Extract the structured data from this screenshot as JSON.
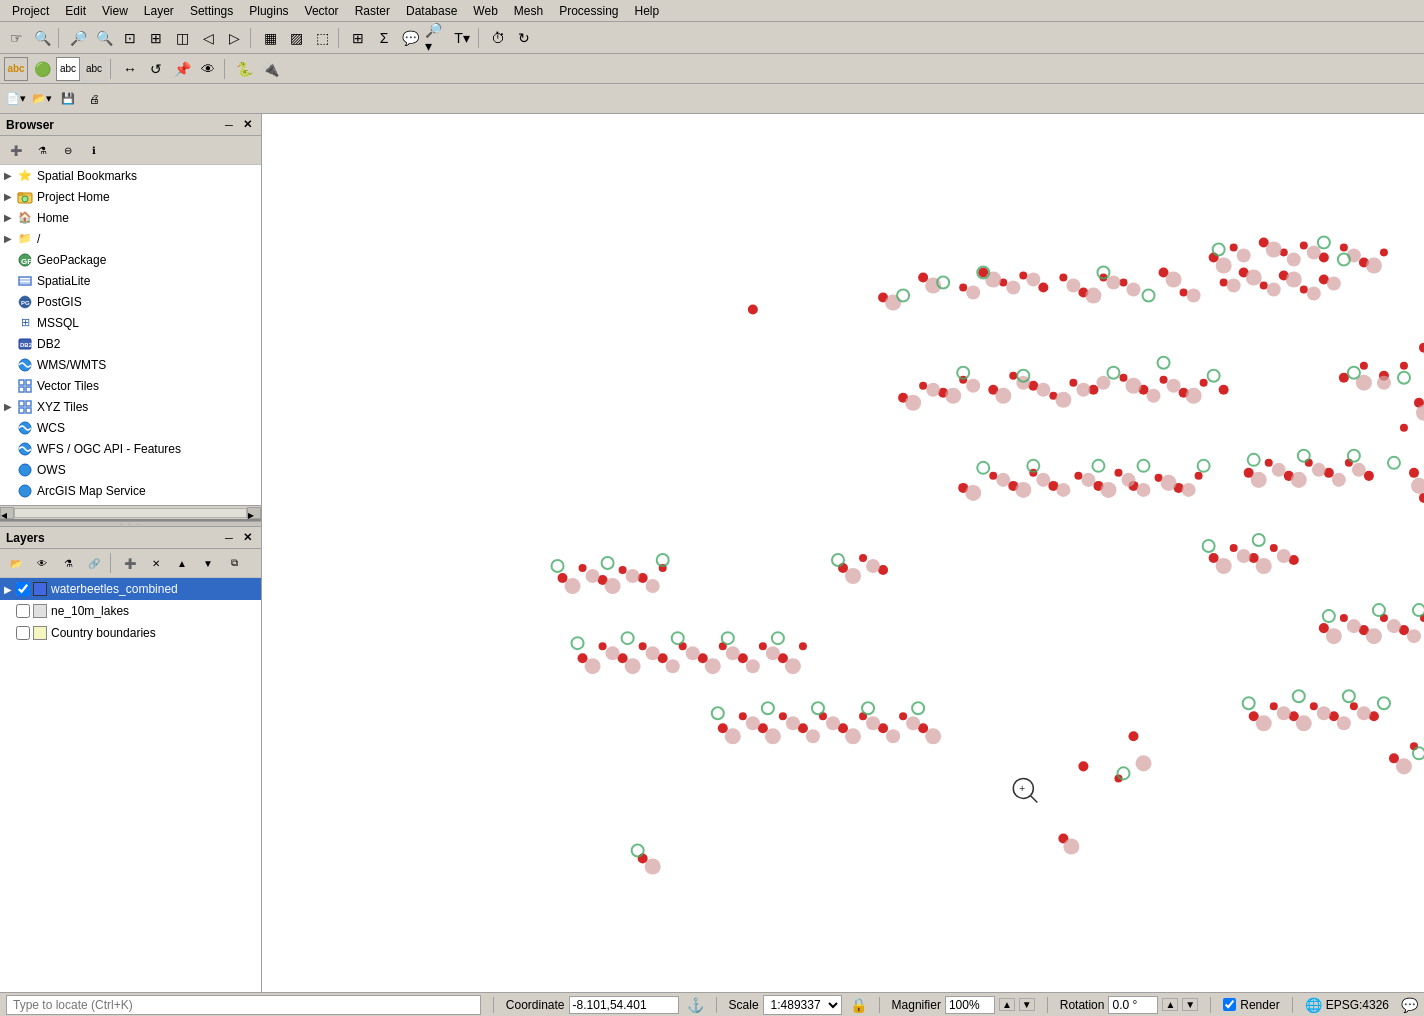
{
  "menubar": {
    "items": [
      {
        "label": "Project",
        "underline": 0
      },
      {
        "label": "Edit",
        "underline": 0
      },
      {
        "label": "View",
        "underline": 0
      },
      {
        "label": "Layer",
        "underline": 0
      },
      {
        "label": "Settings",
        "underline": 0
      },
      {
        "label": "Plugins",
        "underline": 0
      },
      {
        "label": "Vector",
        "underline": 0
      },
      {
        "label": "Raster",
        "underline": 0
      },
      {
        "label": "Database",
        "underline": 0
      },
      {
        "label": "Web",
        "underline": 0
      },
      {
        "label": "Mesh",
        "underline": 0
      },
      {
        "label": "Processing",
        "underline": 0
      },
      {
        "label": "Help",
        "underline": 0
      }
    ]
  },
  "browser": {
    "title": "Browser",
    "items": [
      {
        "label": "Spatial Bookmarks",
        "icon": "bookmark",
        "expandable": true,
        "level": 0
      },
      {
        "label": "Project Home",
        "icon": "folder-project",
        "expandable": true,
        "level": 0
      },
      {
        "label": "Home",
        "icon": "home",
        "expandable": true,
        "level": 0
      },
      {
        "label": "/",
        "icon": "folder",
        "expandable": true,
        "level": 0
      },
      {
        "label": "GeoPackage",
        "icon": "geopackage",
        "expandable": false,
        "level": 0
      },
      {
        "label": "SpatiaLite",
        "icon": "spatialite",
        "expandable": false,
        "level": 0
      },
      {
        "label": "PostGIS",
        "icon": "postgis",
        "expandable": false,
        "level": 0
      },
      {
        "label": "MSSQL",
        "icon": "mssql",
        "expandable": false,
        "level": 0
      },
      {
        "label": "DB2",
        "icon": "db2",
        "expandable": false,
        "level": 0
      },
      {
        "label": "WMS/WMTS",
        "icon": "wms",
        "expandable": false,
        "level": 0
      },
      {
        "label": "Vector Tiles",
        "icon": "vector-tiles",
        "expandable": false,
        "level": 0
      },
      {
        "label": "XYZ Tiles",
        "icon": "xyz",
        "expandable": true,
        "level": 0
      },
      {
        "label": "WCS",
        "icon": "wcs",
        "expandable": false,
        "level": 0
      },
      {
        "label": "WFS / OGC API - Features",
        "icon": "wfs",
        "expandable": false,
        "level": 0
      },
      {
        "label": "OWS",
        "icon": "ows",
        "expandable": false,
        "level": 0
      },
      {
        "label": "ArcGIS Map Service",
        "icon": "arcgis",
        "expandable": false,
        "level": 0
      }
    ]
  },
  "layers": {
    "title": "Layers",
    "items": [
      {
        "label": "waterbeetles_combined",
        "checked": true,
        "color": "#4169E1",
        "active": true
      },
      {
        "label": "ne_10m_lakes",
        "checked": false,
        "color": "#e8e8e8"
      },
      {
        "label": "Country boundaries",
        "checked": false,
        "color": "#f5f5c8"
      }
    ]
  },
  "statusbar": {
    "coordinate_label": "Coordinate",
    "coordinate_value": "-8.101,54.401",
    "scale_label": "Scale",
    "scale_value": "1:489337",
    "magnifier_label": "Magnifier",
    "magnifier_value": "100%",
    "rotation_label": "Rotation",
    "rotation_value": "0.0 °",
    "render_label": "Render",
    "render_checked": true,
    "epsg_label": "EPSG:4326"
  },
  "locatebar": {
    "placeholder": "Type to locate (Ctrl+K)"
  }
}
